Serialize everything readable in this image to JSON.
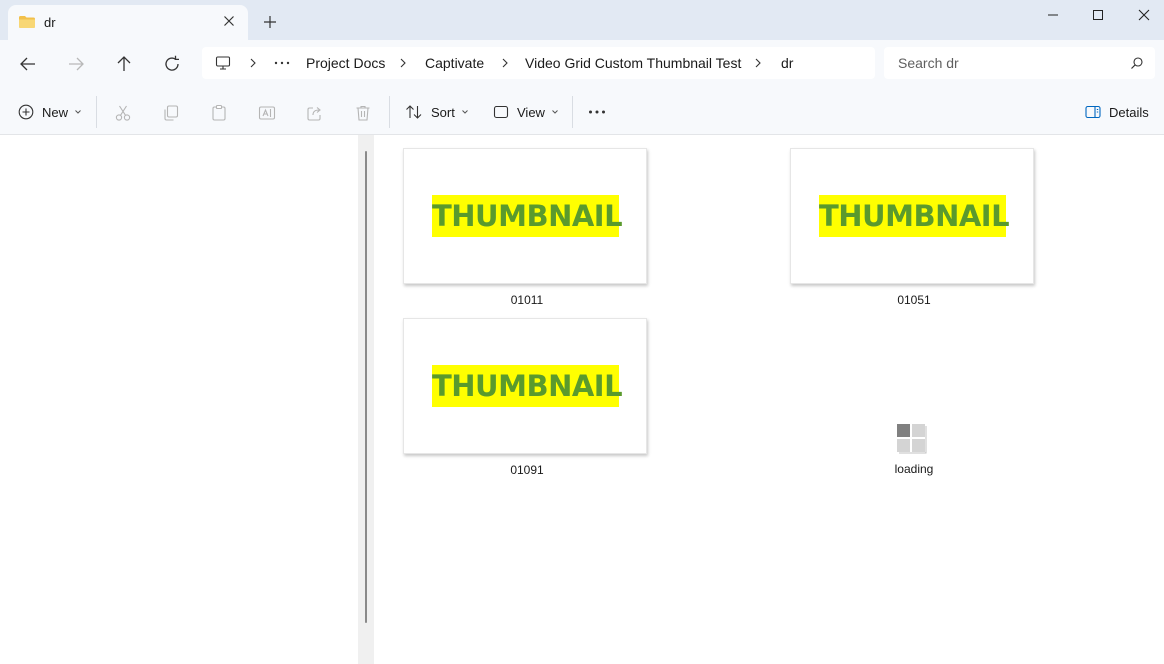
{
  "tab": {
    "title": "dr"
  },
  "breadcrumb": {
    "items": [
      "Project Docs",
      "Captivate",
      "Video Grid Custom Thumbnail Test",
      "dr"
    ]
  },
  "search": {
    "placeholder": "Search dr"
  },
  "toolbar": {
    "new_label": "New",
    "sort_label": "Sort",
    "view_label": "View",
    "details_label": "Details"
  },
  "files": [
    {
      "name": "01011",
      "thumbnail_text": "THUMBNAIL"
    },
    {
      "name": "01051",
      "thumbnail_text": "THUMBNAIL"
    },
    {
      "name": "01091",
      "thumbnail_text": "THUMBNAIL"
    },
    {
      "name": "loading",
      "thumbnail_text": ""
    }
  ],
  "colors": {
    "thumbnail_highlight": "#ffff00",
    "thumbnail_text": "#5a9a2d",
    "folder": "#f2c04b",
    "details_accent": "#0067c0"
  },
  "icons": [
    "folder-icon",
    "close-icon",
    "plus-icon",
    "minimize-icon",
    "maximize-icon",
    "back-icon",
    "forward-icon",
    "up-icon",
    "refresh-icon",
    "computer-icon",
    "more-icon",
    "search-icon",
    "cut-icon",
    "copy-icon",
    "paste-icon",
    "rename-icon",
    "share-icon",
    "delete-icon",
    "sort-icon",
    "view-icon",
    "details-pane-icon",
    "generic-file-icon"
  ]
}
